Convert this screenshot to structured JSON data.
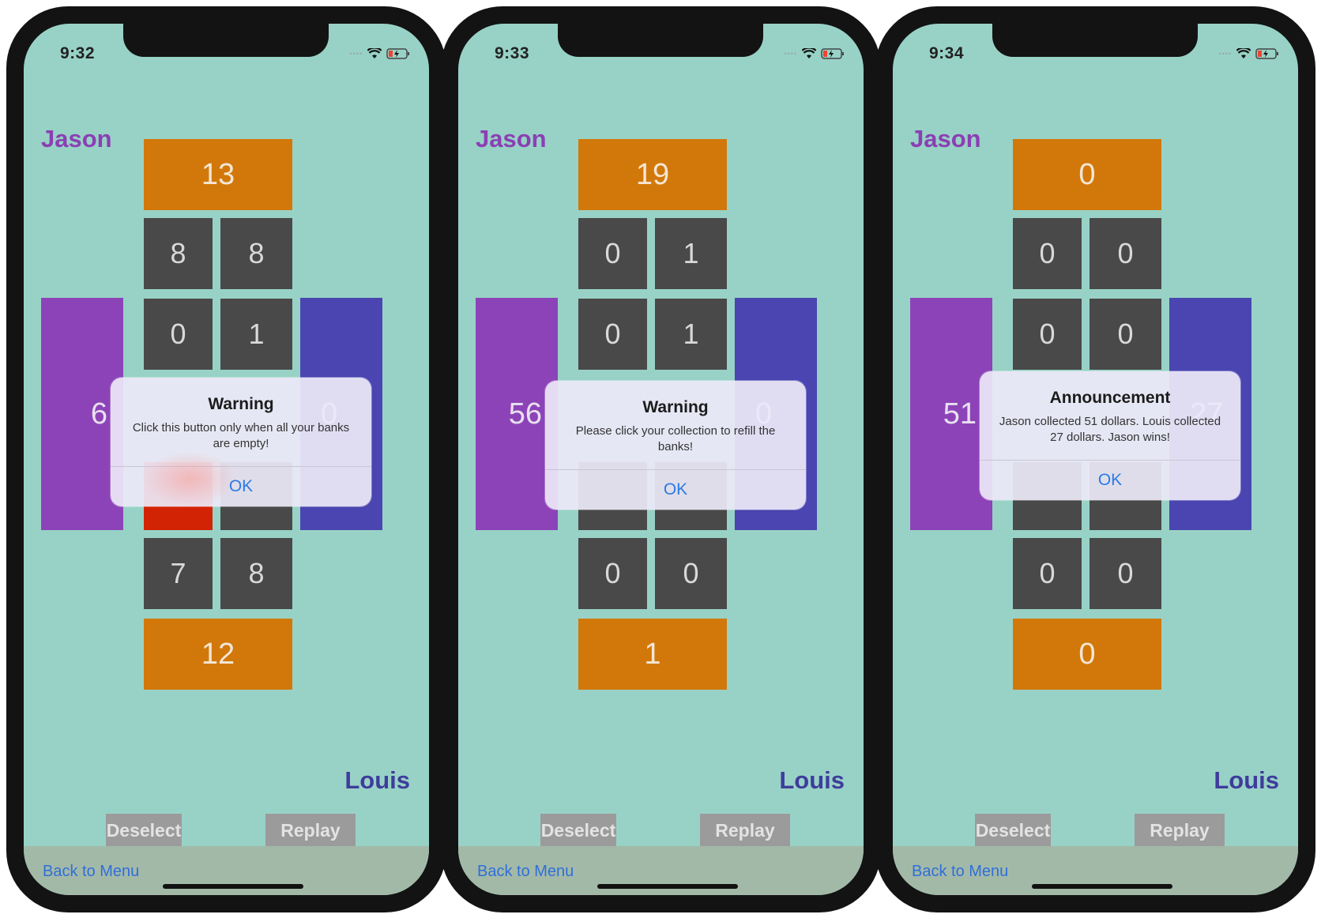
{
  "phones": [
    {
      "time": "9:32",
      "players": {
        "top": "Jason",
        "bottom": "Louis"
      },
      "board": {
        "top_collection": "13",
        "banks": [
          "8",
          "8",
          "0",
          "1",
          "",
          "",
          "7",
          "8"
        ],
        "bottom_collection": "12",
        "left_store": "6",
        "right_store": "0"
      },
      "buttons": {
        "deselect": "Deselect",
        "replay": "Replay"
      },
      "back_link": "Back to Menu",
      "alert": {
        "title": "Warning",
        "message": "Click this button only when all your banks are empty!",
        "ok": "OK"
      }
    },
    {
      "time": "9:33",
      "players": {
        "top": "Jason",
        "bottom": "Louis"
      },
      "board": {
        "top_collection": "19",
        "banks": [
          "0",
          "1",
          "0",
          "1",
          "",
          "",
          "0",
          "0"
        ],
        "bottom_collection": "1",
        "left_store": "56",
        "right_store": "0"
      },
      "buttons": {
        "deselect": "Deselect",
        "replay": "Replay"
      },
      "back_link": "Back to Menu",
      "alert": {
        "title": "Warning",
        "message": "Please click your collection to refill the banks!",
        "ok": "OK"
      }
    },
    {
      "time": "9:34",
      "players": {
        "top": "Jason",
        "bottom": "Louis"
      },
      "board": {
        "top_collection": "0",
        "banks": [
          "0",
          "0",
          "0",
          "0",
          "",
          "",
          "0",
          "0"
        ],
        "bottom_collection": "0",
        "left_store": "51",
        "right_store": "27"
      },
      "buttons": {
        "deselect": "Deselect",
        "replay": "Replay"
      },
      "back_link": "Back to Menu",
      "alert": {
        "title": "Announcement",
        "message": "Jason collected 51 dollars. Louis collected 27 dollars. Jason wins!",
        "ok": "OK"
      }
    }
  ],
  "colors": {
    "background": "#98d2c6",
    "collection": "#d2780a",
    "bank": "#494949",
    "selected_bank": "#d22405",
    "left_store": "#8d43b8",
    "right_store": "#4a45b0",
    "link": "#2f6fd8"
  },
  "icons": [
    "wifi-icon",
    "battery-icon",
    "signal-icon"
  ]
}
